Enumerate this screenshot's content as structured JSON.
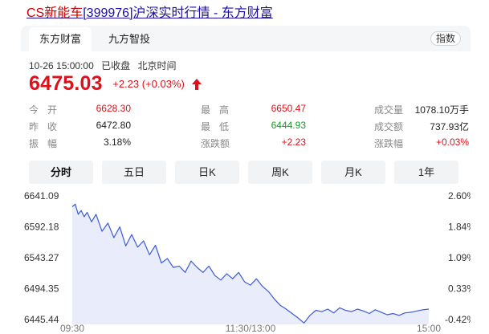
{
  "page": {
    "title_brand": "CS新能车",
    "title_rest": "[399976]沪深实时行情 - 东方财富"
  },
  "tabs": {
    "eastmoney": "东方财富",
    "jiufang": "九方智投",
    "index_button": "指数"
  },
  "quote": {
    "time": "10-26 15:00:00",
    "status": "已收盘",
    "timezone": "北京时间",
    "price": "6475.03",
    "change": "+2.23 (+0.03%)",
    "direction_icon": "up-arrow-icon",
    "accent_color": "#e0101a"
  },
  "stats": {
    "open_label": "今开",
    "open_value": "6628.30",
    "high_label": "最高",
    "high_value": "6650.47",
    "volume_label": "成交量",
    "volume_value": "1078.10万手",
    "prev_close_label": "昨收",
    "prev_close_value": "6472.80",
    "low_label": "最低",
    "low_value": "6444.93",
    "turnover_label": "成交额",
    "turnover_value": "737.93亿",
    "amplitude_label": "振幅",
    "amplitude_value": "3.18%",
    "change_amount_label": "涨跌额",
    "change_amount_value": "+2.23",
    "change_percent_label": "涨跌幅",
    "change_percent_value": "+0.03%"
  },
  "periods": [
    "分时",
    "五日",
    "日K",
    "周K",
    "月K",
    "1年"
  ],
  "active_period": "分时",
  "chart_data": {
    "type": "area",
    "title": "",
    "x_tick_labels": [
      "09:30",
      "11:30/13:00",
      "15:00"
    ],
    "y_left_ticks": [
      "6641.09",
      "6592.18",
      "6543.27",
      "6494.35",
      "6445.44"
    ],
    "y_right_ticks": [
      "2.60%",
      "1.84%",
      "1.09%",
      "0.33%",
      "-0.42%"
    ],
    "ylim": [
      6445.44,
      6641.09
    ],
    "prev_close": 6472.8,
    "line_color": "#3d5bd6",
    "fill_color": "#e9ecfb",
    "series": [
      {
        "x": [
          0,
          2,
          4,
          6,
          8,
          10,
          13,
          16,
          20,
          24,
          28,
          32,
          36,
          40,
          44,
          48,
          52,
          56,
          60,
          64,
          68,
          72,
          76,
          80,
          84,
          88,
          92,
          96,
          100,
          104,
          108,
          112,
          116,
          120,
          124,
          128,
          132,
          136,
          140,
          144,
          148,
          152,
          156,
          160,
          164,
          168,
          172,
          176,
          180,
          184,
          188,
          192,
          196,
          200,
          204,
          208,
          212,
          216,
          220,
          224,
          228,
          232,
          236,
          240
        ],
        "values": [
          6624,
          6628,
          6612,
          6618,
          6608,
          6615,
          6600,
          6612,
          6585,
          6598,
          6575,
          6592,
          6562,
          6580,
          6560,
          6570,
          6548,
          6563,
          6535,
          6542,
          6528,
          6530,
          6520,
          6538,
          6528,
          6520,
          6530,
          6515,
          6508,
          6518,
          6510,
          6520,
          6505,
          6500,
          6510,
          6498,
          6490,
          6478,
          6468,
          6462,
          6455,
          6448,
          6440,
          6452,
          6460,
          6458,
          6462,
          6456,
          6464,
          6460,
          6458,
          6462,
          6459,
          6455,
          6461,
          6457,
          6453,
          6455,
          6452,
          6456,
          6457,
          6459,
          6461,
          6462
        ]
      }
    ]
  }
}
